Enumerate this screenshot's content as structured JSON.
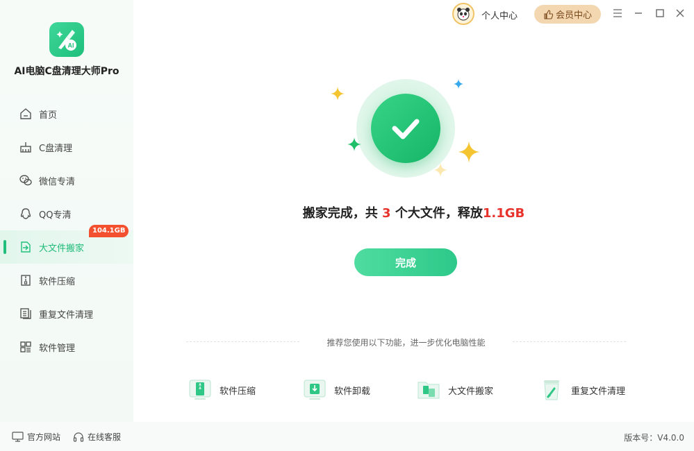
{
  "app": {
    "name": "AI电脑C盘清理大师Pro"
  },
  "header": {
    "user_center": "个人中心",
    "vip_center": "会员中心"
  },
  "sidebar": {
    "items": [
      {
        "label": "首页",
        "icon": "home-icon"
      },
      {
        "label": "C盘清理",
        "icon": "broom-icon"
      },
      {
        "label": "微信专清",
        "icon": "wechat-icon"
      },
      {
        "label": "QQ专清",
        "icon": "qq-icon"
      },
      {
        "label": "大文件搬家",
        "icon": "file-move-icon",
        "active": true,
        "badge": "104.1GB"
      },
      {
        "label": "软件压缩",
        "icon": "zip-icon"
      },
      {
        "label": "重复文件清理",
        "icon": "duplicate-file-icon"
      },
      {
        "label": "软件管理",
        "icon": "apps-icon"
      }
    ]
  },
  "main": {
    "result": {
      "prefix": "搬家完成，共 ",
      "count": "3",
      "middle": " 个大文件，释放",
      "size": "1.1GB"
    },
    "done_button": "完成",
    "recommend_text": "推荐您使用以下功能，进一步优化电脑性能",
    "features": [
      {
        "label": "软件压缩",
        "icon": "zip-icon"
      },
      {
        "label": "软件卸载",
        "icon": "uninstall-icon"
      },
      {
        "label": "大文件搬家",
        "icon": "file-move-icon"
      },
      {
        "label": "重复文件清理",
        "icon": "trash-icon"
      }
    ]
  },
  "footer": {
    "official_site": "官方网站",
    "online_service": "在线客服",
    "version": "版本号：V4.0.0"
  },
  "colors": {
    "accent": "#20c07c",
    "highlight": "#e8322c",
    "badge": "#f2502f",
    "vip": "#f3d7b1"
  }
}
